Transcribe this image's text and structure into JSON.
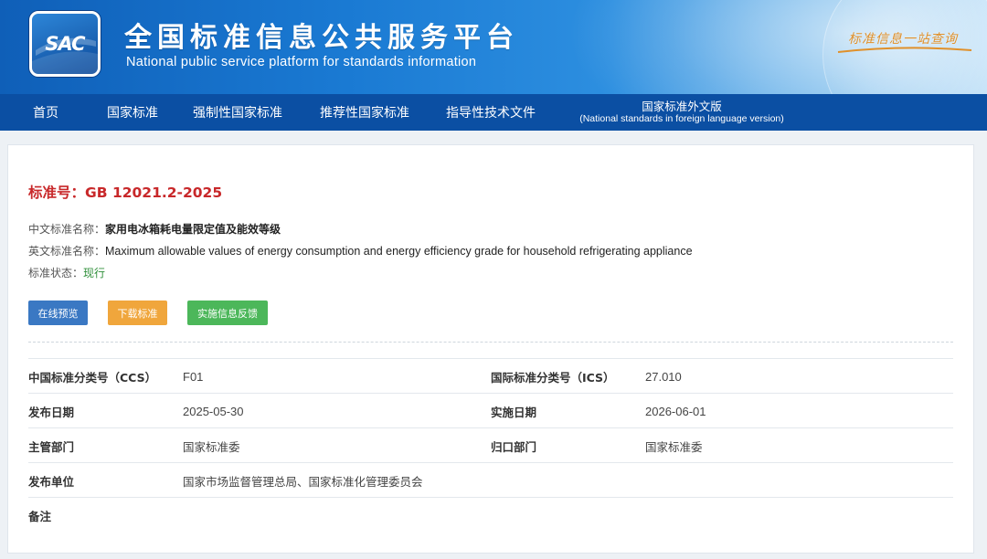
{
  "header": {
    "logo_text": "SAC",
    "title": "全国标准信息公共服务平台",
    "subtitle": "National public service platform  for standards information",
    "slogan": "标准信息一站查询"
  },
  "nav": {
    "items": [
      {
        "label": "首页"
      },
      {
        "label": "国家标准"
      },
      {
        "label": "强制性国家标准"
      },
      {
        "label": "推荐性国家标准"
      },
      {
        "label": "指导性技术文件"
      }
    ],
    "foreign": {
      "label": "国家标准外文版",
      "sub_label": "(National standards in foreign language version)"
    }
  },
  "standard": {
    "number_label": "标准号：",
    "number": "GB 12021.2-2025",
    "cn_name_label": "中文标准名称：",
    "cn_name": "家用电冰箱耗电量限定值及能效等级",
    "en_name_label": "英文标准名称：",
    "en_name": "Maximum allowable values of energy consumption and energy efficiency grade for household refrigerating appliance",
    "status_label": "标准状态：",
    "status": "现行"
  },
  "buttons": {
    "preview": "在线预览",
    "download": "下载标准",
    "feedback": "实施信息反馈"
  },
  "details": {
    "ccs_label": "中国标准分类号（CCS）",
    "ccs": "F01",
    "ics_label": "国际标准分类号（ICS）",
    "ics": "27.010",
    "publish_date_label": "发布日期",
    "publish_date": "2025-05-30",
    "implement_date_label": "实施日期",
    "implement_date": "2026-06-01",
    "competent_label": "主管部门",
    "competent": "国家标准委",
    "centralized_label": "归口部门",
    "centralized": "国家标准委",
    "publisher_label": "发布单位",
    "publisher": "国家市场监督管理总局、国家标准化管理委员会",
    "remark_label": "备注"
  },
  "colors": {
    "header_blue": "#0f5fb8",
    "nav_blue": "#0b4fa3",
    "title_red": "#c8282a",
    "status_green": "#2f8f3a",
    "btn_blue": "#3a78c3",
    "btn_orange": "#f0a63c",
    "btn_green": "#4cb75a"
  }
}
